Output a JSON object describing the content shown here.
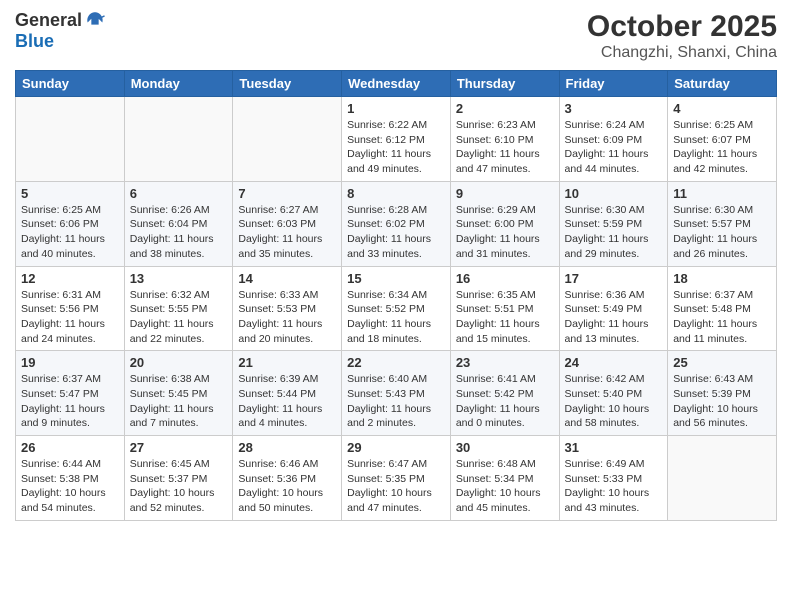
{
  "header": {
    "logo_line1": "General",
    "logo_line2": "Blue",
    "month": "October 2025",
    "location": "Changzhi, Shanxi, China"
  },
  "weekdays": [
    "Sunday",
    "Monday",
    "Tuesday",
    "Wednesday",
    "Thursday",
    "Friday",
    "Saturday"
  ],
  "weeks": [
    [
      {
        "day": "",
        "info": ""
      },
      {
        "day": "",
        "info": ""
      },
      {
        "day": "",
        "info": ""
      },
      {
        "day": "1",
        "info": "Sunrise: 6:22 AM\nSunset: 6:12 PM\nDaylight: 11 hours\nand 49 minutes."
      },
      {
        "day": "2",
        "info": "Sunrise: 6:23 AM\nSunset: 6:10 PM\nDaylight: 11 hours\nand 47 minutes."
      },
      {
        "day": "3",
        "info": "Sunrise: 6:24 AM\nSunset: 6:09 PM\nDaylight: 11 hours\nand 44 minutes."
      },
      {
        "day": "4",
        "info": "Sunrise: 6:25 AM\nSunset: 6:07 PM\nDaylight: 11 hours\nand 42 minutes."
      }
    ],
    [
      {
        "day": "5",
        "info": "Sunrise: 6:25 AM\nSunset: 6:06 PM\nDaylight: 11 hours\nand 40 minutes."
      },
      {
        "day": "6",
        "info": "Sunrise: 6:26 AM\nSunset: 6:04 PM\nDaylight: 11 hours\nand 38 minutes."
      },
      {
        "day": "7",
        "info": "Sunrise: 6:27 AM\nSunset: 6:03 PM\nDaylight: 11 hours\nand 35 minutes."
      },
      {
        "day": "8",
        "info": "Sunrise: 6:28 AM\nSunset: 6:02 PM\nDaylight: 11 hours\nand 33 minutes."
      },
      {
        "day": "9",
        "info": "Sunrise: 6:29 AM\nSunset: 6:00 PM\nDaylight: 11 hours\nand 31 minutes."
      },
      {
        "day": "10",
        "info": "Sunrise: 6:30 AM\nSunset: 5:59 PM\nDaylight: 11 hours\nand 29 minutes."
      },
      {
        "day": "11",
        "info": "Sunrise: 6:30 AM\nSunset: 5:57 PM\nDaylight: 11 hours\nand 26 minutes."
      }
    ],
    [
      {
        "day": "12",
        "info": "Sunrise: 6:31 AM\nSunset: 5:56 PM\nDaylight: 11 hours\nand 24 minutes."
      },
      {
        "day": "13",
        "info": "Sunrise: 6:32 AM\nSunset: 5:55 PM\nDaylight: 11 hours\nand 22 minutes."
      },
      {
        "day": "14",
        "info": "Sunrise: 6:33 AM\nSunset: 5:53 PM\nDaylight: 11 hours\nand 20 minutes."
      },
      {
        "day": "15",
        "info": "Sunrise: 6:34 AM\nSunset: 5:52 PM\nDaylight: 11 hours\nand 18 minutes."
      },
      {
        "day": "16",
        "info": "Sunrise: 6:35 AM\nSunset: 5:51 PM\nDaylight: 11 hours\nand 15 minutes."
      },
      {
        "day": "17",
        "info": "Sunrise: 6:36 AM\nSunset: 5:49 PM\nDaylight: 11 hours\nand 13 minutes."
      },
      {
        "day": "18",
        "info": "Sunrise: 6:37 AM\nSunset: 5:48 PM\nDaylight: 11 hours\nand 11 minutes."
      }
    ],
    [
      {
        "day": "19",
        "info": "Sunrise: 6:37 AM\nSunset: 5:47 PM\nDaylight: 11 hours\nand 9 minutes."
      },
      {
        "day": "20",
        "info": "Sunrise: 6:38 AM\nSunset: 5:45 PM\nDaylight: 11 hours\nand 7 minutes."
      },
      {
        "day": "21",
        "info": "Sunrise: 6:39 AM\nSunset: 5:44 PM\nDaylight: 11 hours\nand 4 minutes."
      },
      {
        "day": "22",
        "info": "Sunrise: 6:40 AM\nSunset: 5:43 PM\nDaylight: 11 hours\nand 2 minutes."
      },
      {
        "day": "23",
        "info": "Sunrise: 6:41 AM\nSunset: 5:42 PM\nDaylight: 11 hours\nand 0 minutes."
      },
      {
        "day": "24",
        "info": "Sunrise: 6:42 AM\nSunset: 5:40 PM\nDaylight: 10 hours\nand 58 minutes."
      },
      {
        "day": "25",
        "info": "Sunrise: 6:43 AM\nSunset: 5:39 PM\nDaylight: 10 hours\nand 56 minutes."
      }
    ],
    [
      {
        "day": "26",
        "info": "Sunrise: 6:44 AM\nSunset: 5:38 PM\nDaylight: 10 hours\nand 54 minutes."
      },
      {
        "day": "27",
        "info": "Sunrise: 6:45 AM\nSunset: 5:37 PM\nDaylight: 10 hours\nand 52 minutes."
      },
      {
        "day": "28",
        "info": "Sunrise: 6:46 AM\nSunset: 5:36 PM\nDaylight: 10 hours\nand 50 minutes."
      },
      {
        "day": "29",
        "info": "Sunrise: 6:47 AM\nSunset: 5:35 PM\nDaylight: 10 hours\nand 47 minutes."
      },
      {
        "day": "30",
        "info": "Sunrise: 6:48 AM\nSunset: 5:34 PM\nDaylight: 10 hours\nand 45 minutes."
      },
      {
        "day": "31",
        "info": "Sunrise: 6:49 AM\nSunset: 5:33 PM\nDaylight: 10 hours\nand 43 minutes."
      },
      {
        "day": "",
        "info": ""
      }
    ]
  ]
}
